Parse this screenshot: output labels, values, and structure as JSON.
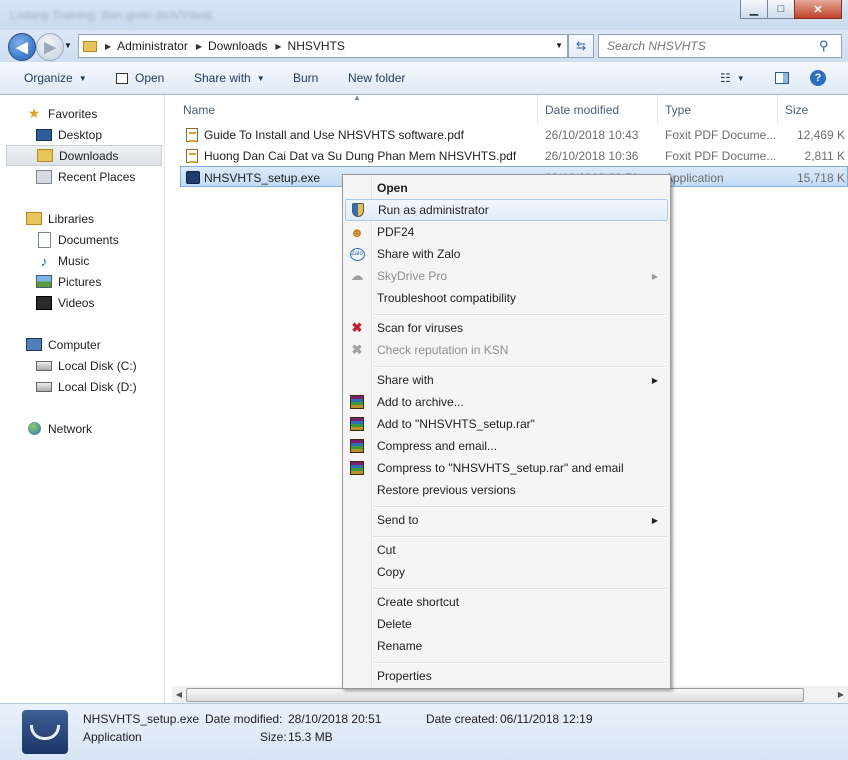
{
  "window": {
    "title_blurred": "Lodanji Training: Ban goito dich/Vdeat"
  },
  "titlebar": {
    "min": "▁",
    "max": "□",
    "close": "✕"
  },
  "address": {
    "crumbs": [
      "Administrator",
      "Downloads",
      "NHSVHTS"
    ],
    "search_placeholder": "Search NHSVHTS"
  },
  "toolbar": {
    "organize": "Organize",
    "open": "Open",
    "share_with": "Share with",
    "burn": "Burn",
    "new_folder": "New folder"
  },
  "nav": {
    "favorites": "Favorites",
    "desktop": "Desktop",
    "downloads": "Downloads",
    "recent": "Recent Places",
    "libraries": "Libraries",
    "documents": "Documents",
    "music": "Music",
    "pictures": "Pictures",
    "videos": "Videos",
    "computer": "Computer",
    "disk_c": "Local Disk (C:)",
    "disk_d": "Local Disk (D:)",
    "network": "Network"
  },
  "columns": {
    "name": "Name",
    "date": "Date modified",
    "type": "Type",
    "size": "Size"
  },
  "files": [
    {
      "name": "Guide To Install and Use NHSVHTS software.pdf",
      "date": "26/10/2018 10:43",
      "type": "Foxit PDF Docume...",
      "size": "12,469 K"
    },
    {
      "name": "Huong Dan Cai Dat va Su Dung Phan Mem NHSVHTS.pdf",
      "date": "26/10/2018 10:36",
      "type": "Foxit PDF Docume...",
      "size": "2,811 K"
    },
    {
      "name": "NHSVHTS_setup.exe",
      "date": "28/10/2018 20:51",
      "type": "Application",
      "size": "15,718 K"
    }
  ],
  "details": {
    "name": "NHSVHTS_setup.exe",
    "kind": "Application",
    "modified_label": "Date modified:",
    "modified": "28/10/2018 20:51",
    "created_label": "Date created:",
    "created": "06/11/2018 12:19",
    "size_label": "Size:",
    "size": "15.3 MB"
  },
  "menu": {
    "open": "Open",
    "run_admin": "Run as administrator",
    "pdf24": "PDF24",
    "zalo": "Share with Zalo",
    "skydrive": "SkyDrive Pro",
    "troubleshoot": "Troubleshoot compatibility",
    "scan": "Scan for viruses",
    "ksn": "Check reputation in KSN",
    "share_with": "Share with",
    "add_archive": "Add to archive...",
    "add_rar": "Add to \"NHSVHTS_setup.rar\"",
    "compress_email": "Compress and email...",
    "compress_rar_email": "Compress to \"NHSVHTS_setup.rar\" and email",
    "restore": "Restore previous versions",
    "send_to": "Send to",
    "cut": "Cut",
    "copy": "Copy",
    "create_shortcut": "Create shortcut",
    "delete": "Delete",
    "rename": "Rename",
    "properties": "Properties"
  }
}
